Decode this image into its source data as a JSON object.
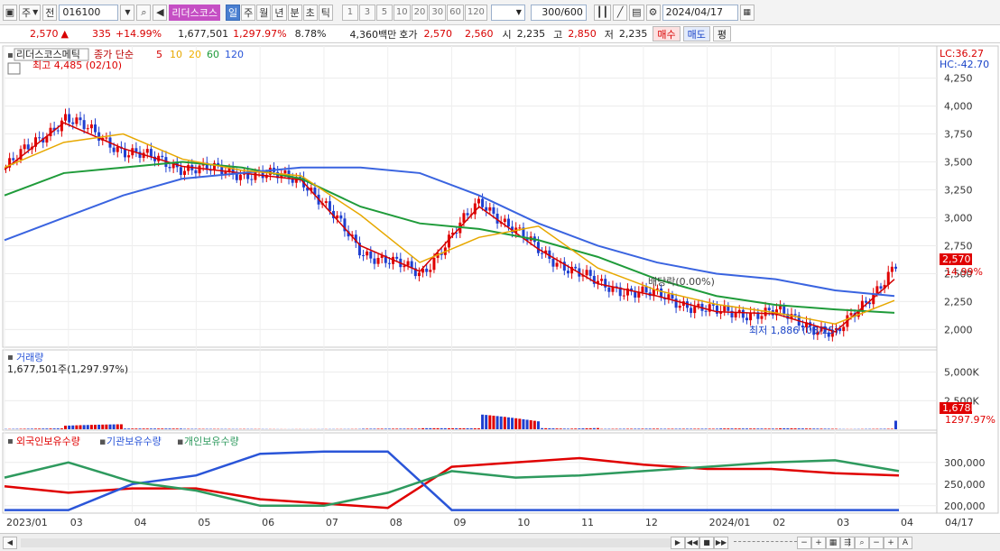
{
  "toolbar": {
    "period_select": "주",
    "mode_select": "전",
    "code": "016100",
    "stock_name": "리더스코스",
    "period_buttons": [
      "일",
      "주",
      "월",
      "년",
      "분",
      "초",
      "틱"
    ],
    "active_period": "일",
    "minute_buttons": [
      "1",
      "3",
      "5",
      "10",
      "20",
      "30",
      "60",
      "120"
    ],
    "count": "300",
    "count_total": "/600",
    "date": "2024/04/17"
  },
  "info": {
    "price": "2,570",
    "arrow": "▲",
    "change": "335",
    "change_pct": "+14.99%",
    "volume": "1,677,501",
    "volume_pct": "1,297.97%",
    "turnover": "8.78%",
    "amount": "4,360백만",
    "quote_label": "호가",
    "ask": "2,570",
    "bid": "2,560",
    "open_label": "시",
    "open": "2,235",
    "high_label": "고",
    "high": "2,850",
    "low_label": "저",
    "low": "2,235",
    "buy_label": "매수",
    "sell_label": "매도",
    "eval_label": "평"
  },
  "price_panel": {
    "stock_tag": "리더스코스메틱",
    "legend_prefix": "종가 단순",
    "ma_periods": [
      "5",
      "10",
      "20",
      "60",
      "120"
    ],
    "max_label": "최고 4,485 (02/10)",
    "min_label": "최저 1,886 (03/25)",
    "dividend_label": "배당락(0.00%)",
    "lc_label": "LC:36.27",
    "hc_label": "HC:-42.70",
    "price_tag": "2,570",
    "pct_tag": "14.99%",
    "y_ticks": [
      "4,250",
      "4,000",
      "3,750",
      "3,500",
      "3,250",
      "3,000",
      "2,750",
      "2,500",
      "2,250",
      "2,000"
    ]
  },
  "volume_panel": {
    "title": "거래량",
    "value_label": "1,677,501주(1,297.97%)",
    "y_ticks": [
      "5,000K",
      "2,500K"
    ],
    "value_tag": "1,678K",
    "pct_tag": "1297.97%"
  },
  "holding_panel": {
    "series_labels": [
      "외국인보유수량",
      "기관보유수량",
      "개인보유수량"
    ],
    "y_ticks": [
      "300,000",
      "250,000",
      "200,000"
    ]
  },
  "x_axis": [
    "2023/01",
    "03",
    "04",
    "05",
    "06",
    "07",
    "08",
    "09",
    "10",
    "11",
    "12",
    "2024/01",
    "02",
    "03",
    "04",
    "04/17"
  ],
  "colors": {
    "up": "#e00000",
    "down": "#1f3fd0",
    "ma5": "#d40000",
    "ma10": "#e7a800",
    "ma20": "#f0b000",
    "ma60": "#1f9b3a",
    "ma120": "#3a64e0",
    "foreign": "#e00000",
    "institution": "#2a55d8",
    "individual": "#2e9a5e"
  },
  "chart_data": {
    "type": "line",
    "x": [
      "2023-01",
      "2023-02",
      "2023-03",
      "2023-04",
      "2023-05",
      "2023-06",
      "2023-07",
      "2023-08",
      "2023-09",
      "2023-10",
      "2023-11",
      "2023-12",
      "2024-01",
      "2024-02",
      "2024-03",
      "2024-04"
    ],
    "series": [
      {
        "name": "종가",
        "values": [
          3450,
          3900,
          3600,
          3450,
          3400,
          3350,
          2700,
          2500,
          3150,
          2700,
          2400,
          2300,
          2150,
          2150,
          1950,
          2570
        ]
      },
      {
        "name": "5",
        "values": [
          3430,
          3850,
          3620,
          3460,
          3400,
          3340,
          2750,
          2520,
          3100,
          2720,
          2410,
          2300,
          2160,
          2140,
          1980,
          2450
        ]
      },
      {
        "name": "60",
        "values": [
          3200,
          3400,
          3450,
          3500,
          3450,
          3350,
          3100,
          2950,
          2900,
          2800,
          2650,
          2450,
          2300,
          2220,
          2180,
          2150
        ]
      },
      {
        "name": "120",
        "values": [
          2800,
          3000,
          3200,
          3350,
          3400,
          3450,
          3450,
          3400,
          3200,
          2950,
          2750,
          2600,
          2500,
          2450,
          2350,
          2300
        ]
      }
    ],
    "ylim": [
      1850,
      4400
    ],
    "volume_k": [
      150,
      600,
      80,
      50,
      60,
      40,
      70,
      120,
      2000,
      300,
      80,
      60,
      90,
      150,
      100,
      1678
    ],
    "volume_ylim": [
      0,
      6000
    ],
    "holdings": {
      "x": [
        "2023/01",
        "03",
        "04",
        "05",
        "06",
        "07",
        "08",
        "09",
        "10",
        "11",
        "12",
        "2024/01",
        "02",
        "03",
        "04"
      ],
      "foreign": [
        245000,
        230000,
        240000,
        240000,
        215000,
        205000,
        195000,
        290000,
        300000,
        310000,
        295000,
        285000,
        285000,
        275000,
        270000
      ],
      "institution": [
        190000,
        190000,
        250000,
        270000,
        320000,
        325000,
        325000,
        190000,
        190000,
        190000,
        190000,
        190000,
        190000,
        190000,
        190000
      ],
      "individual": [
        265000,
        300000,
        255000,
        235000,
        200000,
        200000,
        230000,
        280000,
        265000,
        270000,
        280000,
        290000,
        300000,
        305000,
        280000
      ],
      "ylim": [
        185000,
        335000
      ]
    }
  }
}
